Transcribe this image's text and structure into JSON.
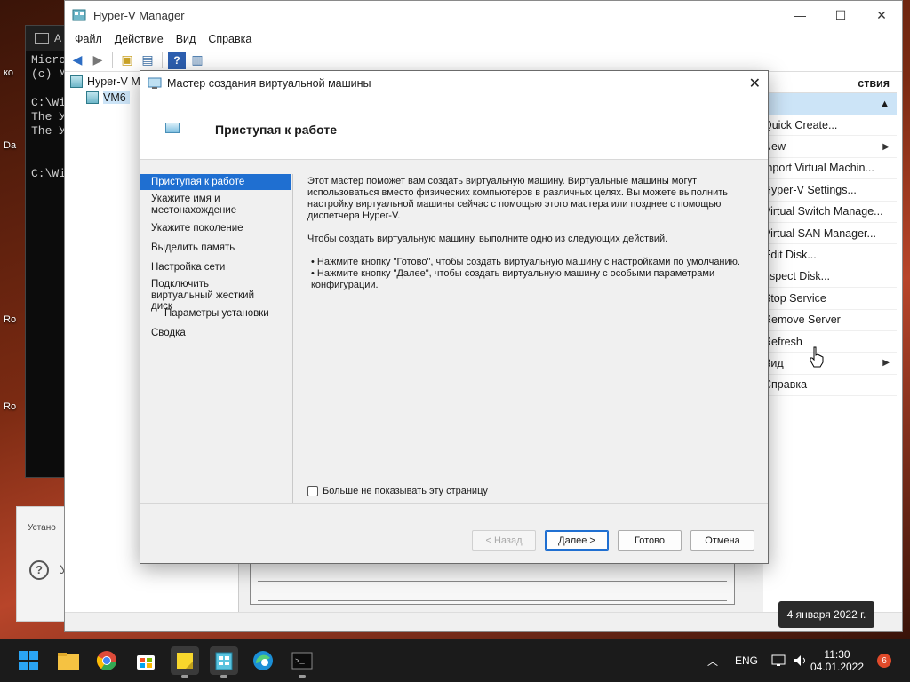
{
  "desktop": {
    "labels": [
      "ко",
      "Da",
      "Ro",
      "Ro"
    ]
  },
  "cmd": {
    "title_text": "А",
    "lines": [
      "Micro",
      "(c) M",
      "",
      "C:\\Wi",
      "The У",
      "The У",
      "",
      "",
      "C:\\Wi"
    ]
  },
  "installer": {
    "label": "Устано",
    "help_text": "У"
  },
  "hyperv": {
    "title": "Hyper-V Manager",
    "menu": [
      "Файл",
      "Действие",
      "Вид",
      "Справка"
    ],
    "tree": {
      "root": "Hyper-V M",
      "child": "VM6"
    },
    "actions_header": "ствия",
    "actions": [
      {
        "label": "Quick Create...",
        "submenu": false
      },
      {
        "label": "New",
        "submenu": true
      },
      {
        "label": "mport Virtual Machin...",
        "submenu": false
      },
      {
        "label": "Hyper-V Settings...",
        "submenu": false
      },
      {
        "label": "Virtual Switch Manage...",
        "submenu": false
      },
      {
        "label": "Virtual SAN Manager...",
        "submenu": false
      },
      {
        "label": "Edit Disk...",
        "submenu": false
      },
      {
        "label": "nspect Disk...",
        "submenu": false
      },
      {
        "label": "Stop Service",
        "submenu": false
      },
      {
        "label": "Remove Server",
        "submenu": false
      },
      {
        "label": "Refresh",
        "submenu": false
      },
      {
        "label": "Вид",
        "submenu": true
      },
      {
        "label": "Справка",
        "submenu": false
      }
    ]
  },
  "wizard": {
    "title": "Мастер создания виртуальной машины",
    "heading": "Приступая к работе",
    "nav": [
      {
        "label": "Приступая к работе",
        "active": true,
        "indent": false
      },
      {
        "label": "Укажите имя и местонахождение",
        "active": false,
        "indent": false
      },
      {
        "label": "Укажите поколение",
        "active": false,
        "indent": false
      },
      {
        "label": "Выделить память",
        "active": false,
        "indent": false
      },
      {
        "label": "Настройка сети",
        "active": false,
        "indent": false
      },
      {
        "label": "Подключить виртуальный жесткий диск",
        "active": false,
        "indent": false
      },
      {
        "label": "Параметры установки",
        "active": false,
        "indent": true
      },
      {
        "label": "Сводка",
        "active": false,
        "indent": false
      }
    ],
    "paragraph1": "Этот мастер поможет вам создать виртуальную машину. Виртуальные машины могут использоваться вместо физических компьютеров в различных целях. Вы можете выполнить настройку виртуальной машины сейчас с помощью этого мастера или позднее с помощью диспетчера Hyper-V.",
    "paragraph2": "Чтобы создать виртуальную машину, выполните одно из следующих действий.",
    "bullet1": "• Нажмите кнопку \"Готово\", чтобы создать виртуальную машину с настройками по умолчанию.",
    "bullet2": "• Нажмите кнопку \"Далее\", чтобы создать виртуальную машину с особыми параметрами конфигурации.",
    "checkbox_label": "Больше не показывать эту страницу",
    "checkbox_checked": false,
    "buttons": {
      "back": "< Назад",
      "next": "Далее >",
      "finish": "Готово",
      "cancel": "Отмена"
    }
  },
  "tooltip": {
    "date": "4 января 2022 г."
  },
  "taskbar": {
    "apps": [
      "start-icon",
      "file-explorer-icon",
      "chrome-icon",
      "store-icon",
      "sticky-notes-icon",
      "hyperv-manager-icon",
      "edge-icon",
      "terminal-icon"
    ],
    "lang": "ENG",
    "time": "11:30",
    "date": "04.01.2022",
    "notifications": "6"
  }
}
